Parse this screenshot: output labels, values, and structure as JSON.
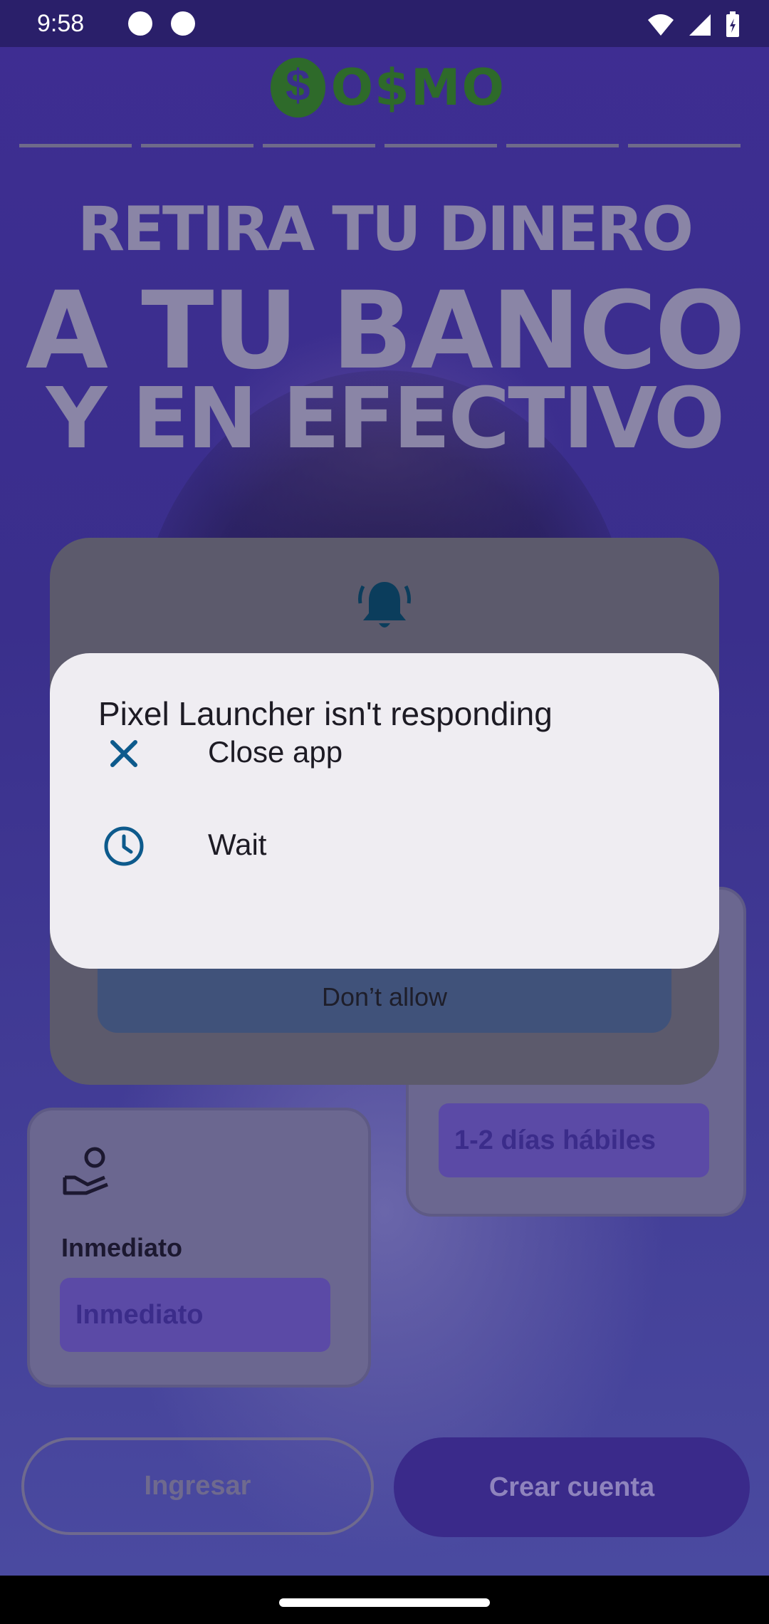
{
  "status_bar": {
    "time": "9:58",
    "icons": [
      "sync-app-icon",
      "cat-app-icon",
      "wifi-icon",
      "signal-icon",
      "battery-icon"
    ]
  },
  "app": {
    "brand": "O$MO",
    "brand_color": "#2e6a2a",
    "hero_line1": "RETIRA TU DINERO",
    "hero_line2": "A TU BANCO",
    "hero_line3": "Y EN EFECTIVO",
    "card_right": {
      "chip": "1-2 días hábiles"
    },
    "card_left": {
      "title": "Inmediato",
      "chip": "Inmediato",
      "icon": "hand-coins-icon"
    },
    "login_button": "Ingresar",
    "signup_button": "Crear cuenta",
    "accent_color": "#3a2a8a"
  },
  "permission_dialog": {
    "icon": "bell-icon",
    "deny_button": "Don’t allow"
  },
  "anr_dialog": {
    "title": "Pixel Launcher isn't responding",
    "options": [
      {
        "label": "Close app",
        "icon": "close-icon"
      },
      {
        "label": "Wait",
        "icon": "clock-icon"
      }
    ],
    "icon_color": "#0d5a8c"
  }
}
